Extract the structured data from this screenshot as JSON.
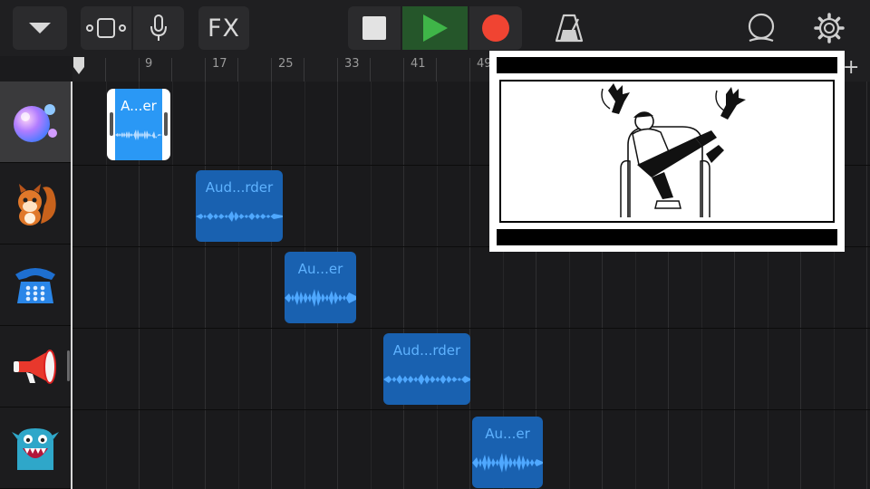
{
  "toolbar": {
    "fx_label": "FX",
    "buttons": [
      "tracks-dropdown",
      "view-toggle",
      "microphone",
      "fx",
      "stop",
      "play",
      "record",
      "metronome",
      "loop-browser",
      "settings"
    ],
    "colors": {
      "play": "#3aa642",
      "record": "#f04432",
      "stop": "#e3e3e3"
    }
  },
  "ruler": {
    "markers": [
      "9",
      "17",
      "25",
      "33",
      "41",
      "49"
    ],
    "add_label": "+"
  },
  "tracks": [
    {
      "icon": "bubbles-icon",
      "selected": true
    },
    {
      "icon": "squirrel-icon",
      "selected": false
    },
    {
      "icon": "telephone-icon",
      "selected": false
    },
    {
      "icon": "megaphone-icon",
      "selected": false
    },
    {
      "icon": "monster-icon",
      "selected": false
    }
  ],
  "regions": [
    {
      "label": "A...er",
      "selected": true
    },
    {
      "label": "Aud...rder",
      "selected": false
    },
    {
      "label": "Au...er",
      "selected": false
    },
    {
      "label": "Aud...rder",
      "selected": false
    },
    {
      "label": "Au...er",
      "selected": false
    }
  ],
  "overlay": {
    "description_icon": "manga-illustration-thumbnail"
  }
}
